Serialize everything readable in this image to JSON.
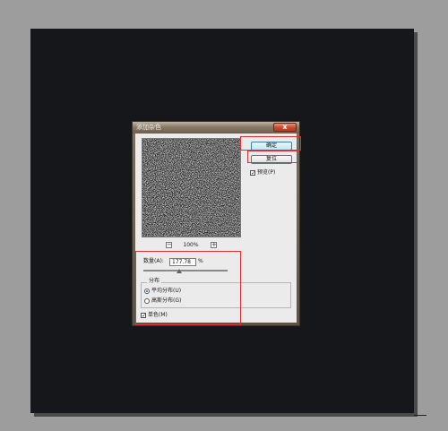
{
  "dialog": {
    "title": "添加杂色",
    "close_glyph": "x",
    "ok_label": "确定",
    "reset_label": "复位",
    "preview_label": "预览(P)",
    "zoom_minus": "−",
    "zoom_plus": "+",
    "zoom_level": "100%",
    "amount_label": "数量(A):",
    "amount_value": "177.78",
    "amount_unit": "%",
    "distribution_legend": "分布",
    "uniform_label": "平均分布(U)",
    "gaussian_label": "高斯分布(G)",
    "mono_label": "单色(M)",
    "preview_checked": true,
    "mono_checked": true,
    "distribution_selected": "uniform",
    "check_glyph": "✓"
  },
  "colors": {
    "workspace_bg": "#9d9d9d",
    "canvas_bg": "#15171b",
    "dialog_bg": "#ebebeb",
    "highlight": "#e03030"
  },
  "icons": {
    "close": "close-icon",
    "zoom_in": "plus-icon",
    "zoom_out": "minus-icon",
    "check": "check-icon"
  }
}
